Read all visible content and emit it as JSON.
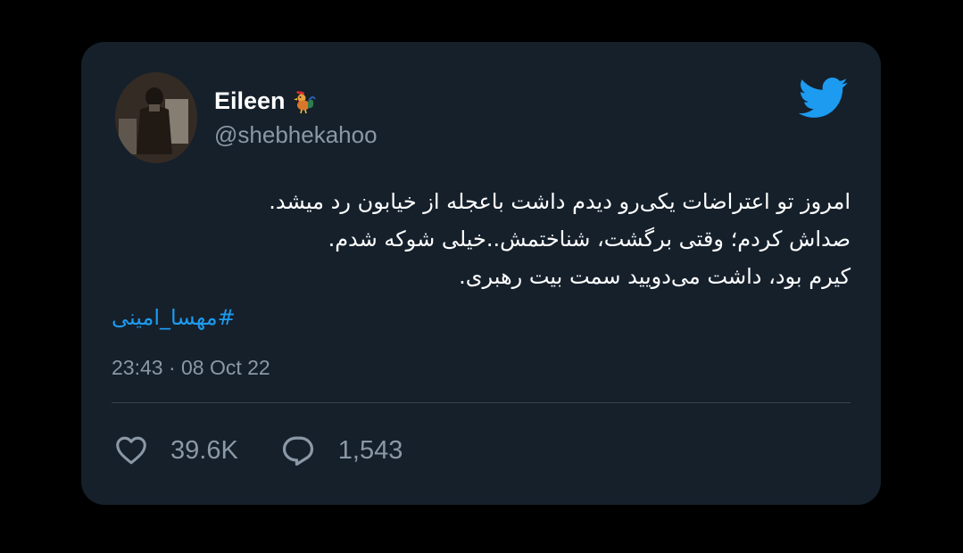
{
  "user": {
    "display_name": "Eileen",
    "name_emoji_icon": "rooster-icon",
    "handle": "@shebhekahoo"
  },
  "tweet": {
    "lines": [
      "امروز تو اعتراضات یکی‌رو دیدم داشت باعجله از خیابون رد میشد.",
      "صداش کردم؛ وقتی برگشت، شناختمش..خیلی شوکه شدم.",
      "کیرم بود، داشت می‌دویید سمت بیت رهبری."
    ],
    "hashtag": "#مهسا_امینی",
    "timestamp": "23:43 · 08 Oct 22"
  },
  "stats": {
    "likes": "39.6K",
    "replies": "1,543"
  },
  "icons": {
    "brand": "twitter-logo",
    "like": "heart-icon",
    "reply": "comment-icon"
  },
  "colors": {
    "card_background": "#15202b",
    "page_background": "#000000",
    "accent": "#1d9bf0",
    "secondary_text": "#8b98a5"
  }
}
